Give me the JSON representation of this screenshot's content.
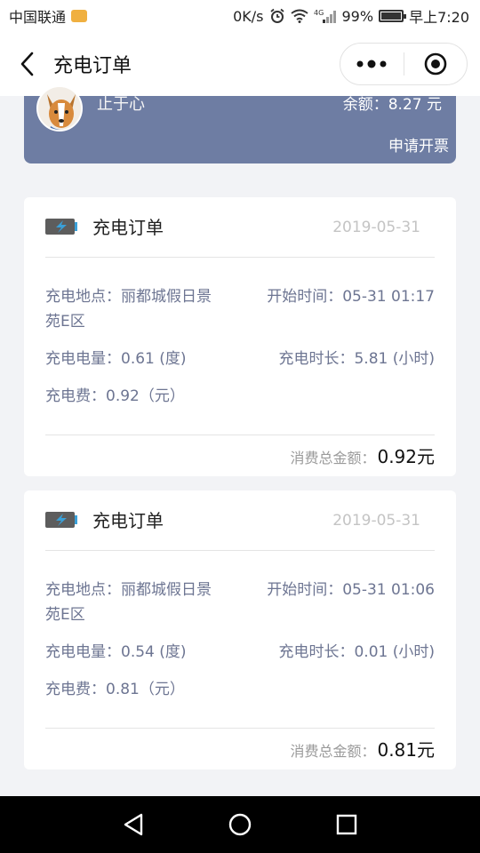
{
  "status_bar": {
    "carrier": "中国联通",
    "speed": "0K/s",
    "battery": "99%",
    "time": "早上7:20",
    "battery_level": 0.99
  },
  "nav": {
    "title": "充电订单",
    "back_icon": "chevron-left-icon",
    "more_icon": "more-dots-icon",
    "close_icon": "target-icon"
  },
  "account": {
    "name": "止于心",
    "balance": "余额：8.27 元",
    "invoice_label": "申请开票",
    "banner_color": "#6e7da3"
  },
  "orders": [
    {
      "title": "充电订单",
      "date": "2019-05-31",
      "location_label": "充电地点：",
      "location_line1": "丽都城假日景",
      "location_line2": "苑E区",
      "start_label": "开始时间：",
      "start_value": "05-31 01:17",
      "energy_label": "充电电量：",
      "energy_value": "0.61 (度)",
      "duration_label": "充电时长：",
      "duration_value": "5.81 (小时)",
      "fee_label": "充电费：",
      "fee_value": "0.92（元）",
      "total_label": "消费总金额：",
      "total_value": "0.92元"
    },
    {
      "title": "充电订单",
      "date": "2019-05-31",
      "location_label": "充电地点：",
      "location_line1": "丽都城假日景",
      "location_line2": "苑E区",
      "start_label": "开始时间：",
      "start_value": "05-31 01:06",
      "energy_label": "充电电量：",
      "energy_value": "0.54 (度)",
      "duration_label": "充电时长：",
      "duration_value": "0.01 (小时)",
      "fee_label": "充电费：",
      "fee_value": "0.81（元）",
      "total_label": "消费总金额：",
      "total_value": "0.81元"
    }
  ],
  "system_nav": {
    "back_icon": "triangle-back-icon",
    "home_icon": "circle-home-icon",
    "recents_icon": "square-recents-icon"
  },
  "colors": {
    "label_text": "#6d7592",
    "date_text": "#c4c4c4",
    "page_bg": "#f2f3f6"
  }
}
